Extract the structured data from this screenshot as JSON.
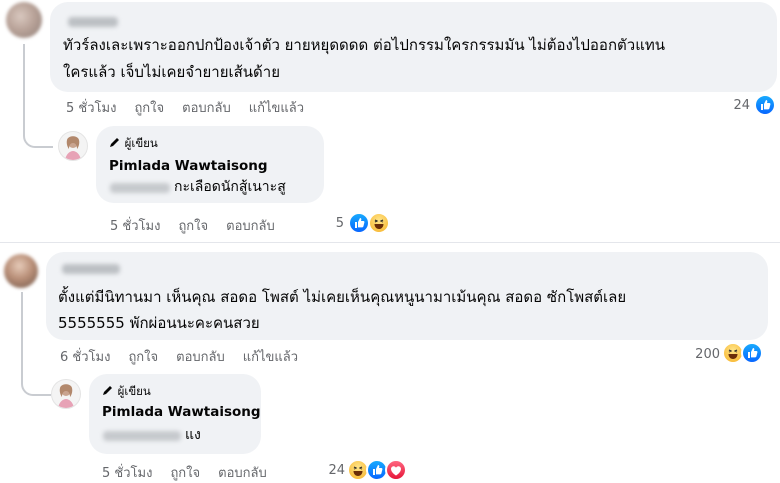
{
  "comments": [
    {
      "text_line1": "ทัวร์ลงเละเพราะออกปกป้องเจ้าตัว ยายหยุดดดด ต่อไปกรรมใครกรรมมัน ไม่ต้องไปออกตัวแทน",
      "text_line2": "ใครแล้ว เจ็บไม่เคยจำยายเส้นด้าย",
      "time": "5 ชั่วโมง",
      "like": "ถูกใจ",
      "reply": "ตอบกลับ",
      "edited": "แก้ไขแล้ว",
      "reaction_count": "24",
      "reply_item": {
        "badge": "ผู้เขียน",
        "author": "Pimlada Wawtaisong",
        "text": "กะเลือดนักสู้เนาะสู",
        "time": "5 ชั่วโมง",
        "like": "ถูกใจ",
        "reply": "ตอบกลับ",
        "reaction_count": "5"
      }
    },
    {
      "text_line1": "ตั้งแต่มีนิทานมา เห็นคุณ สอดอ โพสต์ ไม่เคยเห็นคุณหนูนามาเม้นคุณ สอดอ ซักโพสต์เลย",
      "text_line2": "5555555 พักผ่อนนะคะคนสวย",
      "time": "6 ชั่วโมง",
      "like": "ถูกใจ",
      "reply": "ตอบกลับ",
      "edited": "แก้ไขแล้ว",
      "reaction_count": "200",
      "reply_item": {
        "badge": "ผู้เขียน",
        "author": "Pimlada Wawtaisong",
        "text": "แง",
        "time": "5 ชั่วโมง",
        "like": "ถูกใจ",
        "reply": "ตอบกลับ",
        "reaction_count": "24"
      }
    }
  ],
  "icons": [
    "like-reaction-icon",
    "haha-reaction-icon",
    "love-reaction-icon",
    "pen-icon"
  ],
  "colors": {
    "like_blue": "#0866ff",
    "bubble": "#f0f2f5",
    "meta_gray": "#65676b",
    "haha_yellow": "#f7b125",
    "love_red": "#e61739"
  }
}
